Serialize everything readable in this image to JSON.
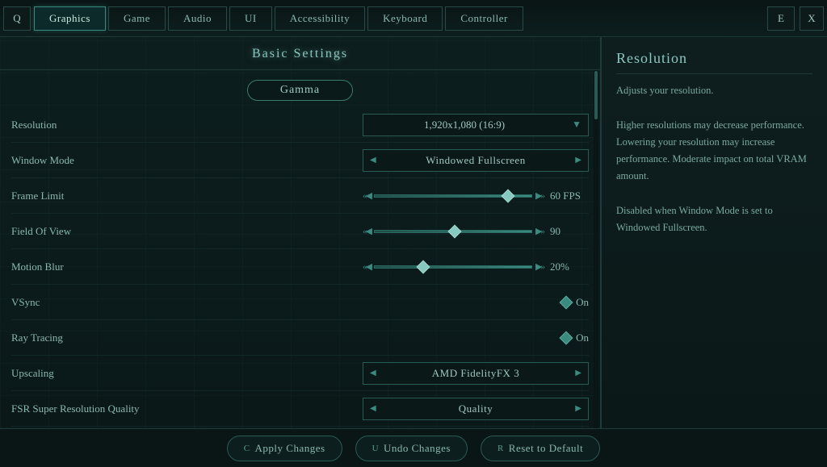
{
  "nav": {
    "q_label": "Q",
    "tabs": [
      {
        "id": "graphics",
        "label": "Graphics",
        "active": true
      },
      {
        "id": "game",
        "label": "Game",
        "active": false
      },
      {
        "id": "audio",
        "label": "Audio",
        "active": false
      },
      {
        "id": "ui",
        "label": "UI",
        "active": false
      },
      {
        "id": "accessibility",
        "label": "Accessibility",
        "active": false
      },
      {
        "id": "keyboard",
        "label": "Keyboard",
        "active": false
      },
      {
        "id": "controller",
        "label": "Controller",
        "active": false
      }
    ],
    "e_label": "E",
    "x_label": "X"
  },
  "left_panel": {
    "section_title": "Basic Settings",
    "gamma_label": "Gamma",
    "settings": [
      {
        "id": "resolution",
        "label": "Resolution",
        "type": "dropdown-chevron",
        "value": "1,920x1,080 (16:9)"
      },
      {
        "id": "window_mode",
        "label": "Window Mode",
        "type": "dropdown-arrows",
        "value": "Windowed Fullscreen"
      },
      {
        "id": "frame_limit",
        "label": "Frame Limit",
        "type": "slider",
        "slider_position": 0.85,
        "value": "60 FPS"
      },
      {
        "id": "field_of_view",
        "label": "Field Of View",
        "type": "slider",
        "slider_position": 0.5,
        "value": "90"
      },
      {
        "id": "motion_blur",
        "label": "Motion Blur",
        "type": "slider",
        "slider_position": 0.3,
        "value": "20%"
      },
      {
        "id": "vsync",
        "label": "VSync",
        "type": "toggle",
        "value": "On"
      },
      {
        "id": "ray_tracing",
        "label": "Ray Tracing",
        "type": "toggle",
        "value": "On"
      },
      {
        "id": "upscaling",
        "label": "Upscaling",
        "type": "dropdown-arrows",
        "value": "AMD FidelityFX 3"
      },
      {
        "id": "fsr_quality",
        "label": "FSR Super Resolution Quality",
        "type": "dropdown-arrows",
        "value": "Quality"
      }
    ]
  },
  "right_panel": {
    "title": "Resolution",
    "description": "Adjusts your resolution.\n\nHigher resolutions may decrease performance. Lowering your resolution may increase performance. Moderate impact on total VRAM amount.\n\nDisabled when Window Mode is set to Windowed Fullscreen."
  },
  "bottom_bar": {
    "apply": {
      "kbd": "C",
      "label": "Apply Changes"
    },
    "undo": {
      "kbd": "U",
      "label": "Undo Changes"
    },
    "reset": {
      "kbd": "R",
      "label": "Reset to Default"
    }
  }
}
